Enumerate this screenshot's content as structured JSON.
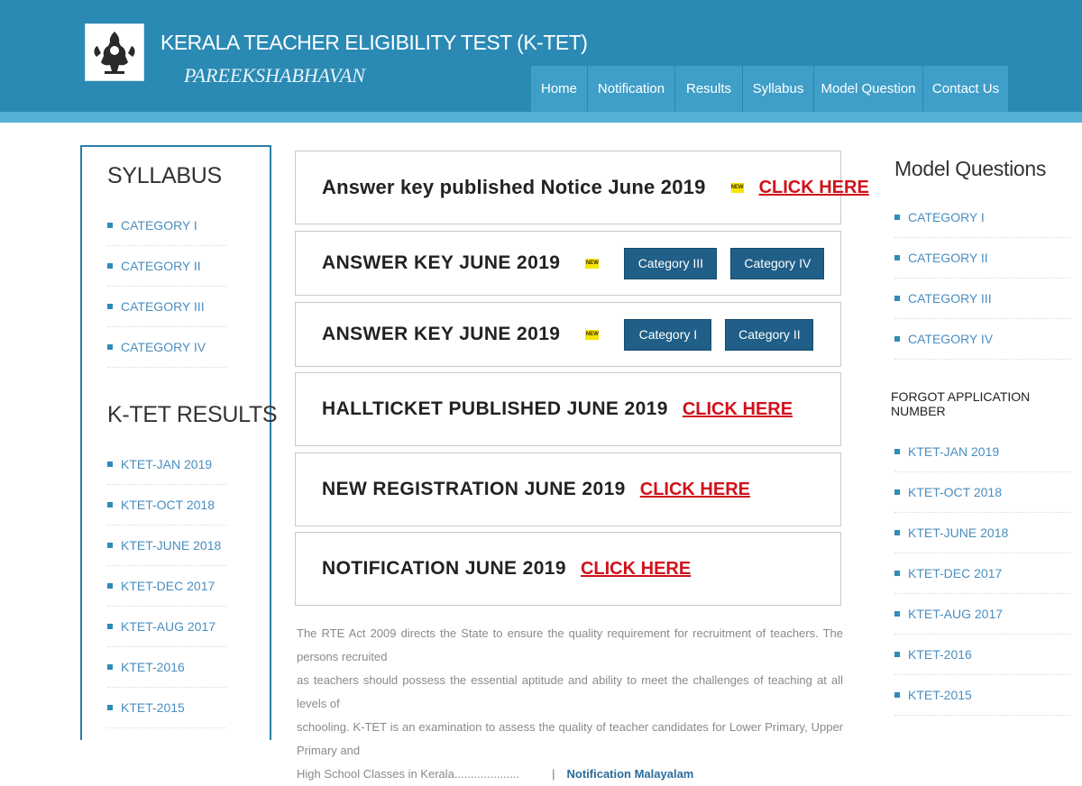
{
  "header": {
    "title": "KERALA TEACHER ELIGIBILITY TEST (K-TET)",
    "subtitle": "PAREEKSHABHAVAN",
    "logo_icon": "kerala-emblem-icon",
    "colors": {
      "header": "#2a8ab4",
      "nav": "#3f9fc8",
      "accent_red": "#d0121b",
      "button": "#1f5f88"
    }
  },
  "nav": {
    "items": [
      "Home",
      "Notification",
      "Results",
      "Syllabus",
      "Model Question",
      "Contact Us"
    ]
  },
  "left": {
    "syllabus_heading": "SYLLABUS",
    "syllabus_items": [
      "CATEGORY I",
      "CATEGORY II",
      "CATEGORY III",
      "CATEGORY IV"
    ],
    "results_heading": "K-TET RESULTS",
    "results_items": [
      "KTET-JAN 2019",
      "KTET-OCT 2018",
      "KTET-JUNE 2018",
      "KTET-DEC 2017",
      "KTET-AUG 2017",
      "KTET-2016",
      "KTET-2015"
    ]
  },
  "notices": [
    {
      "title": "Answer key published Notice June 2019",
      "badge": "NEW",
      "link": "CLICK HERE"
    },
    {
      "title": "ANSWER KEY JUNE 2019",
      "badge": "NEW",
      "buttons": [
        "Category III",
        "Category IV"
      ]
    },
    {
      "title": "ANSWER KEY JUNE 2019",
      "badge": "NEW",
      "buttons": [
        "Category I",
        "Category II"
      ]
    },
    {
      "title": "HALLTICKET PUBLISHED JUNE 2019",
      "link": "CLICK HERE"
    },
    {
      "title": "NEW REGISTRATION JUNE 2019",
      "link": "CLICK HERE"
    },
    {
      "title": "NOTIFICATION JUNE 2019",
      "link": "CLICK HERE"
    }
  ],
  "intro": {
    "lines": [
      "The RTE Act 2009 directs the State to ensure the quality requirement for recruitment of teachers. The persons recruited",
      "as teachers should possess the essential aptitude and ability to meet the challenges of teaching at all levels of",
      "schooling. K-TET is an examination to assess the quality of teacher candidates for Lower Primary, Upper Primary and",
      "High School Classes in Kerala...................."
    ],
    "separator": "|",
    "link": "Notification Malayalam"
  },
  "right": {
    "heading": "Model Questions",
    "model_items": [
      "CATEGORY I",
      "CATEGORY II",
      "CATEGORY III",
      "CATEGORY IV"
    ],
    "forgot": "FORGOT APPLICATION NUMBER",
    "results_items": [
      "KTET-JAN 2019",
      "KTET-OCT 2018",
      "KTET-JUNE 2018",
      "KTET-DEC 2017",
      "KTET-AUG 2017",
      "KTET-2016",
      "KTET-2015"
    ]
  }
}
